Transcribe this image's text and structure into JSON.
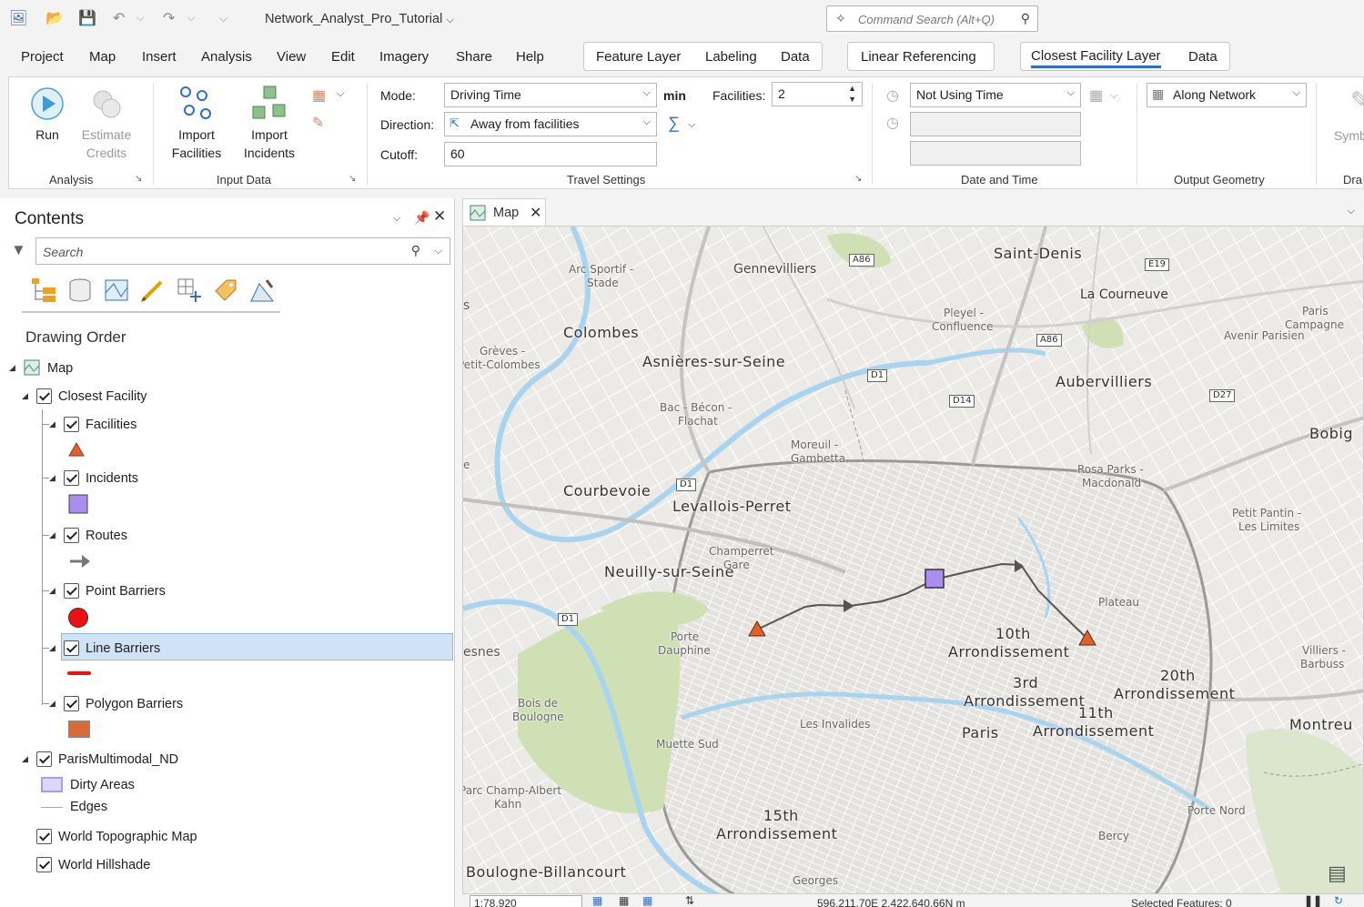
{
  "app": {
    "document_title": "Network_Analyst_Pro_Tutorial",
    "command_search_placeholder": "Command Search (Alt+Q)"
  },
  "menu": {
    "items": [
      "Project",
      "Map",
      "Insert",
      "Analysis",
      "View",
      "Edit",
      "Imagery",
      "Share",
      "Help"
    ],
    "ctx_group1": [
      "Feature Layer",
      "Labeling",
      "Data"
    ],
    "ctx_group2": [
      "Linear Referencing"
    ],
    "ctx_group3": [
      "Closest Facility Layer",
      "Data"
    ]
  },
  "ribbon": {
    "analysis": {
      "run": "Run",
      "estimate_line1": "Estimate",
      "estimate_line2": "Credits",
      "label": "Analysis"
    },
    "input_data": {
      "import_fac_line1": "Import",
      "import_fac_line2": "Facilities",
      "import_inc_line1": "Import",
      "import_inc_line2": "Incidents",
      "label": "Input Data"
    },
    "travel": {
      "mode_label": "Mode:",
      "mode_value": "Driving Time",
      "mode_unit": "min",
      "direction_label": "Direction:",
      "direction_value": "Away from facilities",
      "cutoff_label": "Cutoff:",
      "cutoff_value": "60",
      "facilities_label": "Facilities:",
      "facilities_value": "2",
      "label": "Travel Settings"
    },
    "datetime": {
      "time_value": "Not Using Time",
      "label": "Date and Time"
    },
    "output": {
      "value": "Along Network",
      "label": "Output Geometry"
    },
    "draw": {
      "symb": "Symb",
      "label": "Dra"
    }
  },
  "contents": {
    "title": "Contents",
    "search_placeholder": "Search",
    "drawing_order": "Drawing Order",
    "layers": {
      "map": "Map",
      "closest_facility": "Closest Facility",
      "facilities": "Facilities",
      "incidents": "Incidents",
      "routes": "Routes",
      "point_barriers": "Point Barriers",
      "line_barriers": "Line Barriers",
      "polygon_barriers": "Polygon Barriers",
      "network": "ParisMultimodal_ND",
      "dirty_areas": "Dirty Areas",
      "edges": "Edges",
      "topo": "World Topographic Map",
      "hillshade": "World Hillshade"
    }
  },
  "map_view": {
    "tab_label": "Map",
    "places": {
      "saint_denis": "Saint-Denis",
      "gennevilliers": "Gennevilliers",
      "la_courneuve": "La Courneuve",
      "colombes": "Colombes",
      "asnieres": "Asnières-sur-Seine",
      "aubervilliers": "Aubervilliers",
      "courbevoie": "Courbevoie",
      "levallois": "Levallois-Perret",
      "neuilly": "Neuilly-sur-Seine",
      "bobigny": "Bobig",
      "montreuil": "Montreu",
      "boulogne": "Boulogne-Billancourt",
      "paris": "Paris",
      "arr10_a": "10th",
      "arr10_b": "Arrondissement",
      "arr20_a": "20th",
      "arr20_b": "Arrondissement",
      "arr11_a": "11th",
      "arr11_b": "Arrondissement",
      "arr3_a": "3rd",
      "arr3_b": "Arrondissement",
      "arr15_a": "15th",
      "arr15_b": "Arrondissement",
      "arc_sportif_a": "Arc Sportif -",
      "arc_sportif_b": "Stade",
      "pleyel_a": "Pleyel -",
      "pleyel_b": "Confluence",
      "paris_campagne_a": "Paris",
      "paris_campagne_b": "Campagne",
      "avenir": "Avenir Parisien",
      "greves_a": "Grèves -",
      "greves_b": "Petit-Colombes",
      "bac_a": "Bac - Bécon -",
      "bac_b": "Flachat",
      "moreuil_a": "Moreuil -",
      "moreuil_b": "Gambetta",
      "rosa_a": "Rosa Parks -",
      "rosa_b": "Macdonald",
      "petit_pantin_a": "Petit Pantin -",
      "petit_pantin_b": "Les Limites",
      "villiers_a": "Villiers -",
      "villiers_b": "Barbuss",
      "bois_a": "Bois de",
      "bois_b": "Boulogne",
      "plateau": "Plateau",
      "champerret_a": "Champerret",
      "champerret_b": "Gare",
      "porte_a": "Porte",
      "porte_b": "Dauphine",
      "invalides": "Les Invalides",
      "muette": "Muette Sud",
      "parc_a": "Parc Champ-Albert",
      "parc_b": "Kahn",
      "porte_nord": "Porte Nord",
      "bercy": "Bercy",
      "georges": "Georges",
      "esnes": "esnes",
      "s": "s",
      "e": "e"
    },
    "shields": {
      "a86a": "A86",
      "e19": "E19",
      "a86b": "A86",
      "d1a": "D1",
      "d14": "D14",
      "d27": "D27",
      "d1b": "D1",
      "d1c": "D1"
    }
  },
  "status": {
    "scale": "1:78,920",
    "coords": "596,211.70E 2,422,640.66N m",
    "selected": "Selected Features: 0"
  },
  "colors": {
    "accent": "#2b6fc9",
    "facility": "#e0622a",
    "incident": "#a98ef0",
    "point_barrier": "#ee1111",
    "line_barrier": "#ee1111",
    "polygon_barrier": "#d96b3b",
    "route": "#555555"
  }
}
